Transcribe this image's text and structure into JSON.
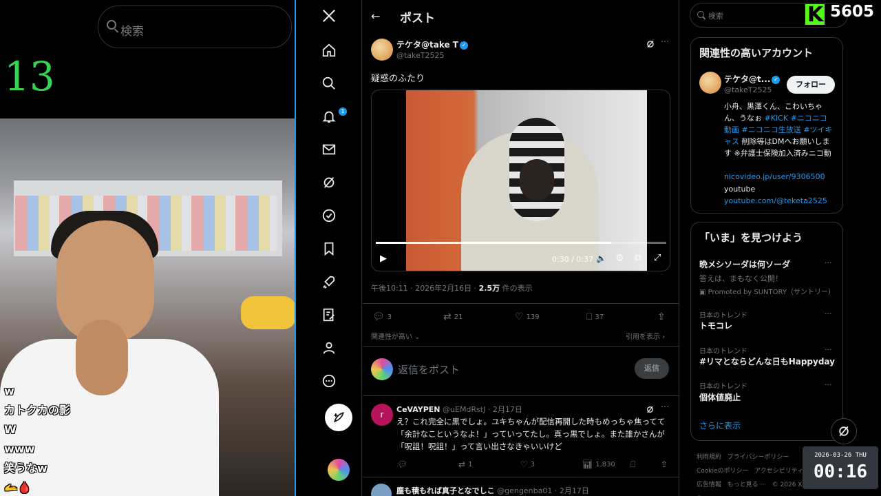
{
  "stream": {
    "left_search_placeholder": "検索",
    "counter": "13",
    "viewer_count": "5605",
    "chat": [
      "w",
      "カトクカの影",
      "W",
      "www",
      "笑うなw"
    ],
    "clock_date": "2026-03-26 THU",
    "clock_time": "00:16"
  },
  "nav": {
    "icons": [
      "x-logo-icon",
      "home-icon",
      "search-icon",
      "bell-icon",
      "mail-icon",
      "grok-icon",
      "verified-icon",
      "bookmark-icon",
      "rocket-icon",
      "edit-list-icon",
      "profile-icon",
      "more-icon"
    ],
    "notification_count": "1"
  },
  "header": {
    "title": "ポスト"
  },
  "post": {
    "author_name": "テケタ@take T",
    "author_handle": "@takeT2525",
    "text": "疑惑のふたり",
    "video_time": "0:30 / 0:37",
    "video_progress": 0.81,
    "timestamp": "午後10:11 · 2026年2月16日 · ",
    "views": "2.5万",
    "views_suffix": " 件の表示",
    "stats": {
      "replies": "3",
      "reposts": "21",
      "likes": "139",
      "bookmarks": "37"
    },
    "relevance_label": "関連性が高い",
    "quotes_label": "引用を表示"
  },
  "reply_box": {
    "placeholder": "返信をポスト",
    "button": "返信"
  },
  "replies": [
    {
      "avatar_letter": "r",
      "name": "CeVAYPEN",
      "handle_date": "@uEMdRstJ · 2月17日",
      "text": "え？これ完全に黒でしょ。ユキちゃんが配信再開した時もめっちゃ焦ってて「余計なこというなよ！」っていってたし。真っ黒でしょ。また誰かさんが「呪詛！呪詛！」って言い出さなきゃいいけど",
      "stats": {
        "replies": "",
        "reposts": "1",
        "likes": "3",
        "views": "1,830"
      }
    },
    {
      "name": "塵も積もれば真子となでしこ",
      "handle_date": "@gengenba01 · 2月17日"
    }
  ],
  "right": {
    "search_placeholder": "検索",
    "related_title": "関連性の高いアカウント",
    "related_account": {
      "name": "テケタ@t...",
      "handle": "@takeT2525",
      "follow": "フォロー",
      "bio_plain_1": "小舟、黒澤くん、こわいちゃん、うなぉ ",
      "bio_tags": "#KICK #ニコニコ動画 #ニコニコ生放送 #ツイキャス",
      "bio_plain_2": " 削除等はDMへお願いします ※弁護士保険加入済みニコ動",
      "link1": "nicovideo.jp/user/9306500",
      "link2_label": "youtube",
      "link2": "youtube.com/@teketa2525"
    },
    "trends_title": "「いま」を見つけよう",
    "ad": {
      "name": "晩メシソーダは何ソーダ",
      "sub": "答えは、まもなく公開！",
      "promoted": "Promoted by SUNTORY（サントリー）"
    },
    "trends": [
      {
        "category": "日本のトレンド",
        "name": "トモコレ"
      },
      {
        "category": "日本のトレンド",
        "name": "#リマとならどんな日もHappyday"
      },
      {
        "category": "日本のトレンド",
        "name": "個体値廃止"
      }
    ],
    "show_more": "さらに表示",
    "footer": [
      "利用規約",
      "プライバシーポリシー",
      "Cookieのポリシー",
      "アクセシビリティ",
      "広告情報",
      "もっと見る ···",
      "© 2026 X Corp."
    ]
  },
  "colors": {
    "accent": "#1d9bf0",
    "kick": "#53fc18",
    "counter": "#39d353"
  }
}
